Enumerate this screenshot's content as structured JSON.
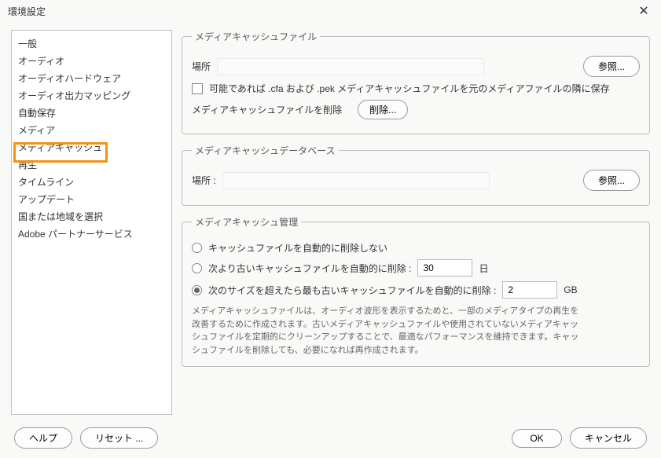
{
  "title": "環境設定",
  "sidebar": {
    "items": [
      "一般",
      "オーディオ",
      "オーディオハードウェア",
      "オーディオ出力マッピング",
      "自動保存",
      "メディア",
      "メディアキャッシュ",
      "再生",
      "タイムライン",
      "アップデート",
      "国または地域を選択",
      "Adobe パートナーサービス"
    ],
    "selected_index": 6
  },
  "sections": {
    "cache_files": {
      "legend": "メディアキャッシュファイル",
      "location_label": "場所",
      "browse_label": "参照...",
      "checkbox_label": "可能であれば .cfa および .pek メディアキャッシュファイルを元のメディアファイルの隣に保存",
      "delete_row_label": "メディアキャッシュファイルを削除",
      "delete_button": "削除..."
    },
    "cache_db": {
      "legend": "メディアキャッシュデータベース",
      "location_label": "場所 :",
      "browse_label": "参照..."
    },
    "cache_mgmt": {
      "legend": "メディアキャッシュ管理",
      "opt_none": "キャッシュファイルを自動的に削除しない",
      "opt_days_label": "次より古いキャッシュファイルを自動的に削除 :",
      "days_value": "30",
      "days_unit": "日",
      "opt_size_label": "次のサイズを超えたら最も古いキャッシュファイルを自動的に削除 :",
      "size_value": "2",
      "size_unit": "GB",
      "help": "メディアキャッシュファイルは、オーディオ波形を表示するためと、一部のメディアタイプの再生を改善するために作成されます。古いメディアキャッシュファイルや使用されていないメディアキャッシュファイルを定期的にクリーンアップすることで、最適なパフォーマンスを維持できます。キャッシュファイルを削除しても、必要になれば再作成されます。"
    }
  },
  "footer": {
    "help": "ヘルプ",
    "reset": "リセット ...",
    "ok": "OK",
    "cancel": "キャンセル"
  }
}
